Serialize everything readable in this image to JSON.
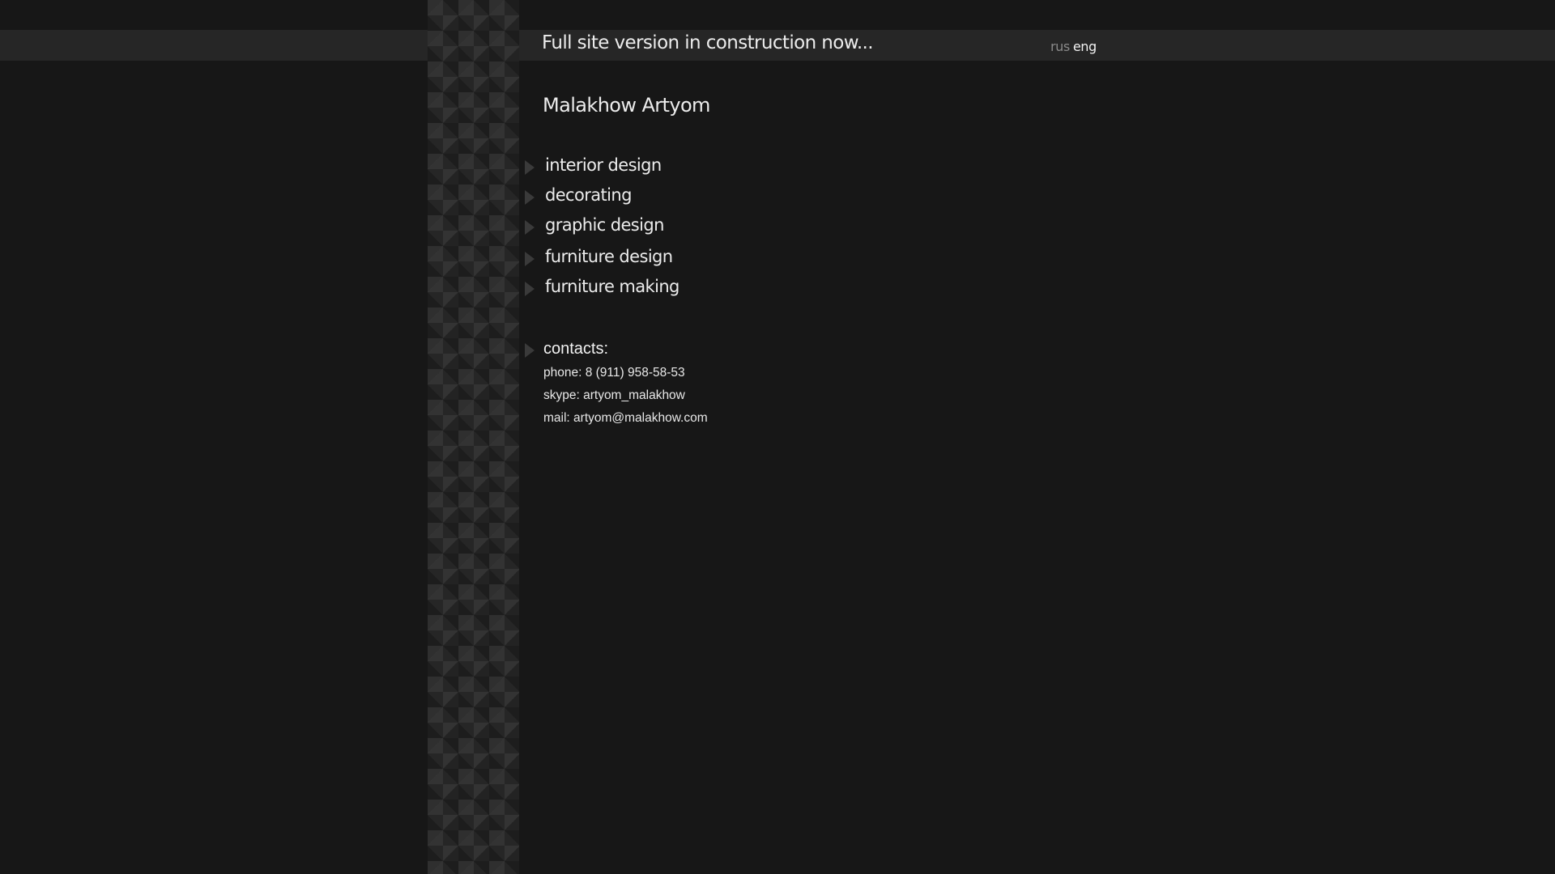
{
  "header": {
    "notice": "Full site version in construction now...",
    "languages": [
      {
        "label": "rus",
        "active": false
      },
      {
        "label": "eng",
        "active": true
      }
    ]
  },
  "owner_name": "Malakhow Artyom",
  "menu": [
    {
      "label": "interior design"
    },
    {
      "label": "decorating"
    },
    {
      "label": "graphic design"
    },
    {
      "label": "furniture design"
    },
    {
      "label": "furniture making"
    }
  ],
  "contacts": {
    "title": "contacts:",
    "phone": "phone: 8 (911) 958-58-53",
    "skype": "skype: artyom_malakhow",
    "mail": "mail: artyom@malakhow.com"
  },
  "colors": {
    "background": "#171717",
    "bar": "#262626",
    "text": "#ececec",
    "inactive_lang": "#8a8a8a"
  }
}
